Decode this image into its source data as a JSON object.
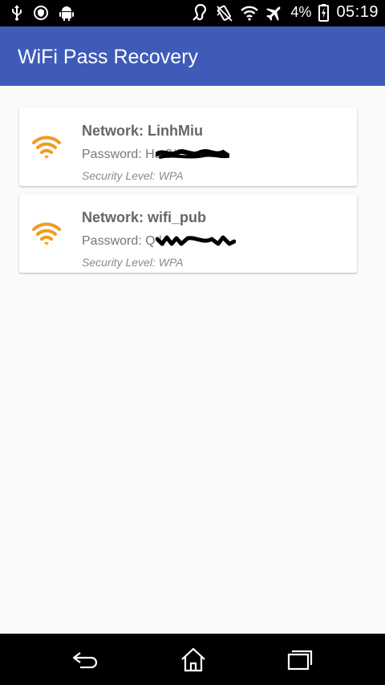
{
  "status_bar": {
    "left_icons": [
      "usb-icon",
      "shield-icon",
      "android-icon"
    ],
    "right_icons": [
      "hearing-aid-icon",
      "vibrate-icon",
      "wifi-signal-icon",
      "airplane-icon",
      "battery-icon"
    ],
    "battery_percent": "4%",
    "time": "05:19"
  },
  "app_bar": {
    "title": "WiFi Pass Recovery"
  },
  "networks": [
    {
      "network": "Network: LinhMiu",
      "password": "Password: Ha            3#",
      "security": "Security Level: WPA",
      "icon": "wifi-icon"
    },
    {
      "network": "Network: wifi_pub",
      "password": "Password: Q             l,",
      "security": "Security Level: WPA",
      "icon": "wifi-icon"
    }
  ],
  "colors": {
    "app_bar": "#3f5bb8",
    "wifi_icon": "#f29b1e",
    "background": "#fafafa"
  },
  "nav_bar": {
    "buttons": [
      "back-icon",
      "home-icon",
      "recent-apps-icon"
    ]
  }
}
